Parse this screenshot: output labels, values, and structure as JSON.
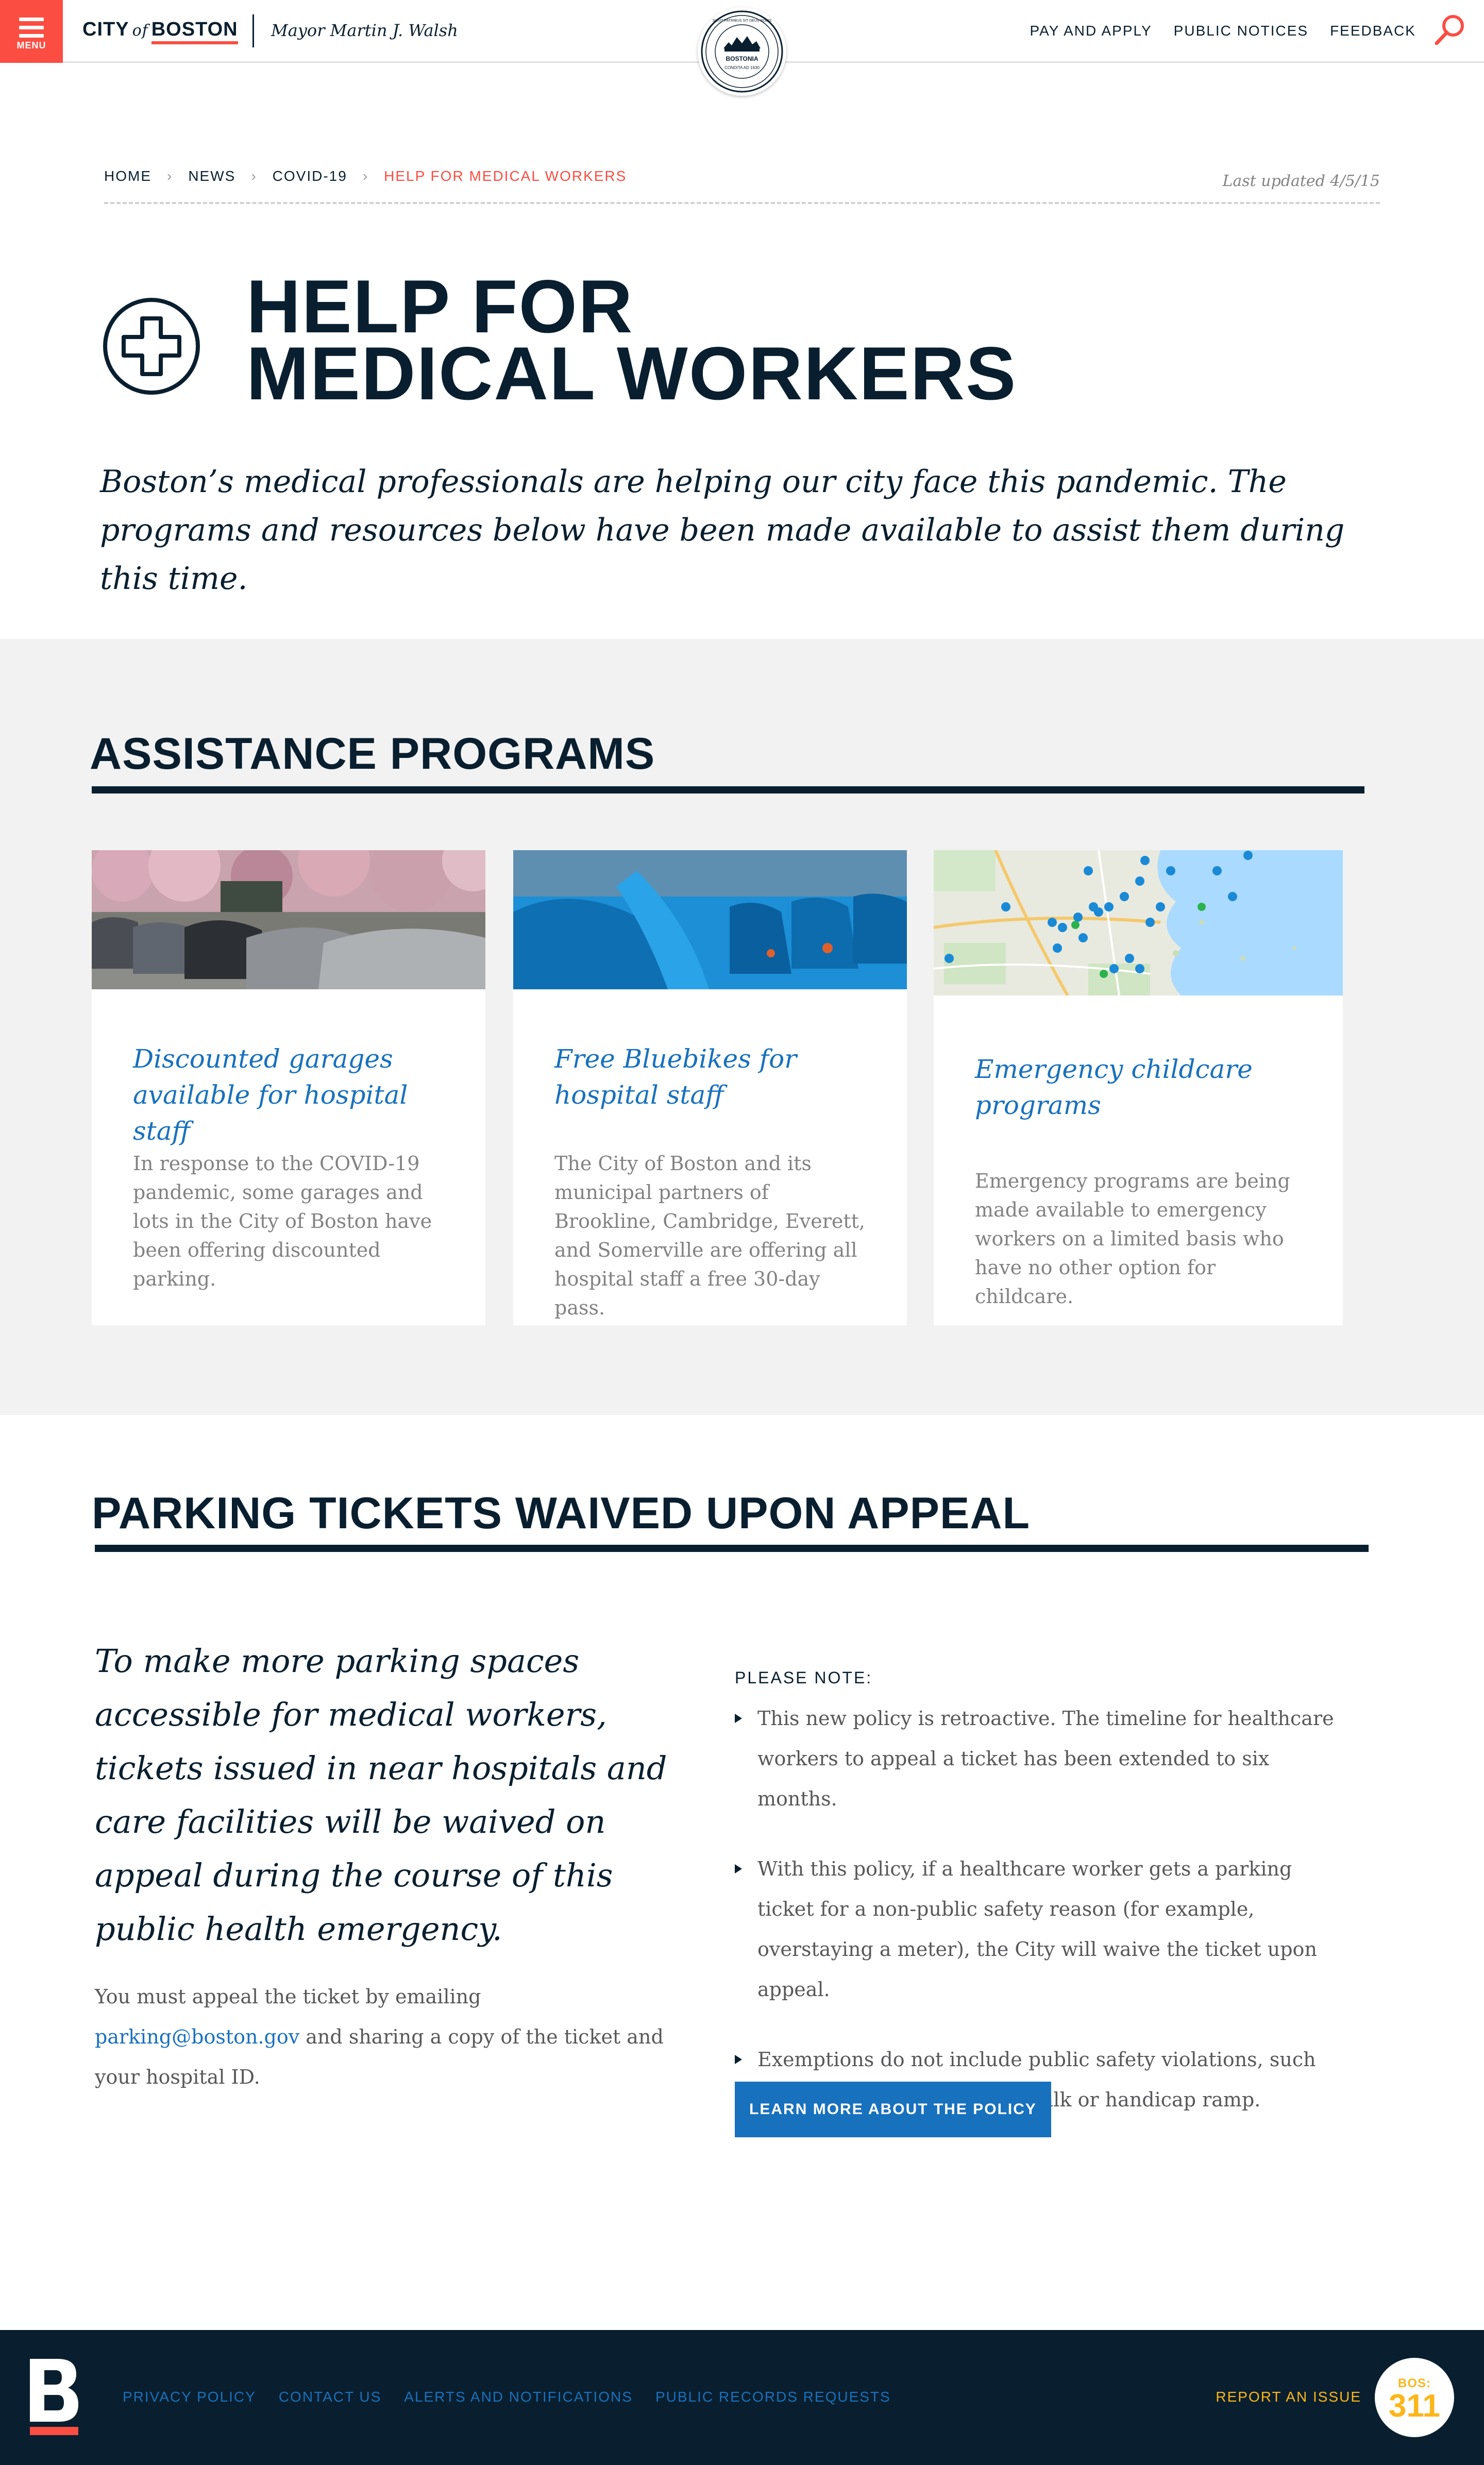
{
  "header": {
    "menu_label": "MENU",
    "logo_city": "CITY",
    "logo_of": "of",
    "logo_boston": "BOSTON",
    "mayor": "Mayor Martin J. Walsh",
    "seal_text_top": "SICUT PATRIBUS SIT DEUS NOBIS",
    "seal_text_name": "BOSTONIA",
    "seal_text_sub": "CONDITA AD 1630",
    "nav": [
      "PAY AND APPLY",
      "PUBLIC NOTICES",
      "FEEDBACK"
    ]
  },
  "breadcrumb": {
    "items": [
      "HOME",
      "NEWS",
      "COVID-19",
      "HELP FOR MEDICAL WORKERS"
    ],
    "last_updated": "Last updated 4/5/15"
  },
  "page": {
    "title_line1": "HELP FOR",
    "title_line2": "MEDICAL WORKERS",
    "intro": "Boston’s medical professionals are helping our city face this pandemic. The programs and resources below have been made available to assist them during this time."
  },
  "assistance": {
    "title": "ASSISTANCE PROGRAMS",
    "cards": [
      {
        "title": "Discounted garages available for hospital staff",
        "desc": "In response to the COVID-19 pandemic, some garages and lots in the City of Boston have been offering discounted parking."
      },
      {
        "title": "Free Bluebikes for hospital staff",
        "desc": "The City of Boston and its municipal partners of Brookline, Cambridge, Everett, and Somerville are offering all hospital staff a free 30-day pass."
      },
      {
        "title": "Emergency childcare programs",
        "desc": "Emergency programs are being made available to emergency workers on a limited basis who have no other option for childcare."
      }
    ]
  },
  "parking": {
    "title": "PARKING TICKETS WAIVED UPON APPEAL",
    "quote": "To make more parking spaces accessible for medical workers, tickets issued in near hospitals and care facilities will be waived on appeal during the course of this public health emergency.",
    "appeal_pre": "You must appeal the ticket by emailing ",
    "appeal_email": "parking@boston.gov",
    "appeal_post": " and sharing a copy of the ticket and your hospital ID.",
    "note_label": "PLEASE NOTE:",
    "notes": [
      "This new policy is retroactive. The timeline for healthcare workers to appeal a ticket has been extended to six months.",
      "With this policy, if a healthcare worker gets a parking ticket for a non-public safety reason (for example, overstaying a meter), the City will waive the ticket upon appeal.",
      "Exemptions do not include public safety violations, such as blocking a hydrant, sidewalk or handicap ramp."
    ],
    "button": "LEARN MORE ABOUT THE POLICY"
  },
  "footer": {
    "links": [
      "PRIVACY POLICY",
      "CONTACT US",
      "ALERTS AND NOTIFICATIONS",
      "PUBLIC RECORDS REQUESTS"
    ],
    "report": "REPORT AN ISSUE",
    "badge_bos": "BOS:",
    "badge_num": "311"
  },
  "colors": {
    "navy": "#091f2f",
    "red": "#fb4d42",
    "blue": "#1871bd",
    "gray_bg": "#f2f2f2",
    "yellow": "#fcb61a"
  }
}
